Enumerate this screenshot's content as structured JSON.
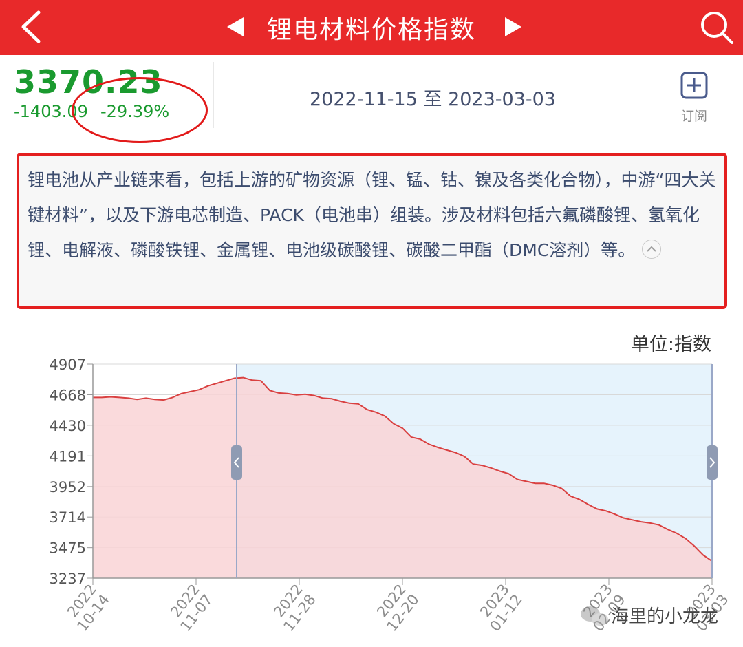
{
  "header": {
    "title": "锂电材料价格指数",
    "back_icon": "back-arrow-icon",
    "prev_icon": "triangle-left-icon",
    "next_icon": "triangle-right-icon",
    "search_icon": "search-icon"
  },
  "quote": {
    "price": "3370.23",
    "change": "-1403.09",
    "change_pct": "-29.39%",
    "date_range": "2022-11-15 至 2023-03-03",
    "subscribe_label": "订阅",
    "subscribe_icon": "plus-square-icon"
  },
  "description": {
    "text": "锂电池从产业链来看，包括上游的矿物资源（锂、锰、钴、镍及各类化合物），中游“四大关键材料”，以及下游电芯制造、PACK（电池串）组装。涉及材料包括六氟磷酸锂、氢氧化锂、电解液、磷酸铁锂、金属锂、电池级碳酸锂、碳酸二甲酯（DMC溶剂）等。"
  },
  "unit_label": "单位:指数",
  "watermark": "海里的小龙龙",
  "colors": {
    "header_bg": "#e8292a",
    "price_green": "#1a9a2f",
    "annotation_red": "#e21a1a",
    "line_red": "#d94040",
    "pink_fill": "#f9d3d6",
    "blue_selection": "#e6f3fc"
  },
  "chart_data": {
    "type": "area",
    "ylabel": "单位:指数",
    "ylim": [
      3237,
      4907
    ],
    "y_ticks": [
      "4907",
      "4668",
      "4430",
      "4191",
      "3952",
      "3714",
      "3475",
      "3237"
    ],
    "x_ticks": [
      "2022\n10-14",
      "2022\n11-07",
      "2022\n11-28",
      "2022\n12-20",
      "2023\n01-12",
      "2023\n02-09",
      "2023\n03-03"
    ],
    "selection_range": [
      "2022-11-15",
      "2023-03-03"
    ],
    "series": [
      {
        "values": [
          4647,
          4647,
          4652,
          4647,
          4642,
          4632,
          4642,
          4632,
          4627,
          4647,
          4677,
          4692,
          4707,
          4737,
          4757,
          4777,
          4797,
          4802,
          4782,
          4777,
          4702,
          4682,
          4677,
          4667,
          4672,
          4662,
          4642,
          4637,
          4617,
          4602,
          4597,
          4552,
          4532,
          4502,
          4442,
          4407,
          4337,
          4322,
          4282,
          4257,
          4237,
          4217,
          4187,
          4127,
          4117,
          4097,
          4072,
          4052,
          4007,
          3992,
          3977,
          3977,
          3962,
          3937,
          3877,
          3852,
          3812,
          3777,
          3762,
          3737,
          3707,
          3692,
          3677,
          3667,
          3652,
          3617,
          3587,
          3547,
          3487,
          3417,
          3370.23
        ]
      }
    ]
  }
}
